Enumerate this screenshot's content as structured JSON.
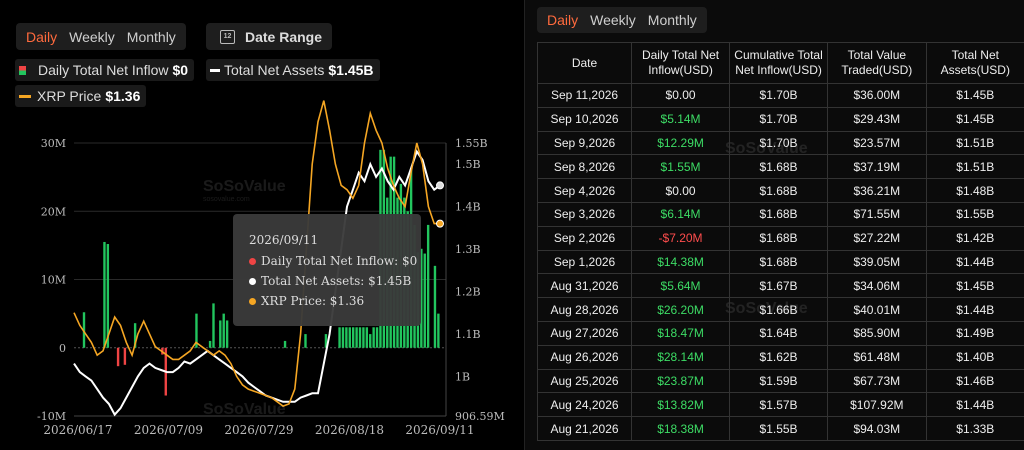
{
  "left": {
    "period_tabs": [
      "Daily",
      "Weekly",
      "Monthly"
    ],
    "active_tab": "Daily",
    "date_range_label": "Date Range",
    "date_range_icon": "calendar-icon",
    "legend": {
      "inflow_label": "Daily Total Net Inflow",
      "inflow_value": "$0",
      "assets_label": "Total Net Assets",
      "assets_value": "$1.45B",
      "price_label": "XRP Price",
      "price_value": "$1.36"
    },
    "watermark": "SoSoValue",
    "watermark_sub": "sosovalue.com",
    "tooltip": {
      "date": "2026/09/11",
      "inflow": "Daily Total Net Inflow: $0",
      "assets": "Total Net Assets: $1.45B",
      "price": "XRP Price: $1.36"
    }
  },
  "chart_data": {
    "type": "bar",
    "x_tick_labels": [
      "2026/06/17",
      "2026/07/09",
      "2026/07/29",
      "2026/08/18",
      "2026/09/11"
    ],
    "y_left_ticks": [
      "30M",
      "20M",
      "10M",
      "0",
      "-10M"
    ],
    "y_right_ticks": [
      "1.55B",
      "1.5B",
      "1.4B",
      "1.3B",
      "1.2B",
      "1.1B",
      "1B",
      "906.59M"
    ],
    "ylim_left": [
      -10,
      30
    ],
    "ylim_right": [
      0.90659,
      1.55
    ],
    "grid": true,
    "colors": {
      "positive": "#22c55e",
      "negative": "#ef4444",
      "assets": "#ffffff",
      "price": "#f5a623"
    },
    "series": [
      {
        "name": "Daily Total Net Inflow",
        "kind": "bar",
        "unit": "M",
        "values": [
          0,
          0,
          5.2,
          0,
          0,
          0,
          0,
          0,
          15.5,
          15.2,
          0,
          0,
          -2.7,
          0,
          -2.5,
          0,
          0,
          3.6,
          0,
          0,
          0,
          0,
          0,
          0,
          0,
          -1,
          -7,
          0,
          0,
          0,
          0,
          0,
          0,
          0,
          0,
          5,
          0,
          0,
          0,
          1,
          6.5,
          0,
          4,
          5,
          4,
          0,
          0,
          0,
          0,
          0,
          0,
          0,
          0,
          0,
          0,
          0,
          0,
          0,
          0,
          0,
          0,
          1,
          0,
          0,
          0,
          0,
          0,
          2,
          0,
          0,
          0,
          0,
          0,
          2,
          0,
          0,
          0,
          3,
          3,
          3,
          3,
          3,
          3,
          3,
          3,
          3,
          2,
          3,
          3,
          29,
          29,
          22,
          28,
          28,
          22,
          24,
          22,
          20,
          26,
          18,
          14,
          14.5,
          13.8,
          18,
          0,
          12,
          5,
          0
        ]
      },
      {
        "name": "Total Net Assets",
        "kind": "line",
        "unit": "B",
        "values": [
          1.03,
          1.01,
          1.0,
          0.99,
          0.97,
          0.95,
          0.935,
          0.91,
          0.925,
          0.95,
          0.975,
          1.0,
          1.02,
          1.03,
          1.02,
          1.015,
          1.01,
          1.01,
          1.02,
          1.035,
          1.03,
          1.04,
          1.05,
          1.06,
          1.05,
          1.04,
          1.03,
          1.02,
          1.01,
          1.0,
          0.985,
          0.975,
          0.965,
          0.955,
          0.95,
          0.945,
          0.94,
          0.94,
          0.94,
          0.95,
          0.955,
          0.96,
          0.96,
          1.03,
          1.1,
          1.2,
          1.3,
          1.4,
          1.44,
          1.48,
          1.46,
          1.5,
          1.47,
          1.49,
          1.46,
          1.44,
          1.47,
          1.45,
          1.49,
          1.53,
          1.51,
          1.46,
          1.44,
          1.45
        ]
      },
      {
        "name": "XRP Price",
        "kind": "line",
        "unit": "$",
        "values": [
          1.15,
          1.12,
          1.1,
          1.08,
          1.05,
          1.06,
          1.1,
          1.14,
          1.12,
          1.08,
          1.05,
          1.1,
          1.13,
          1.1,
          1.07,
          1.06,
          1.05,
          1.04,
          1.04,
          1.05,
          1.06,
          1.08,
          1.07,
          1.06,
          1.05,
          1.06,
          1.05,
          1.03,
          1.0,
          0.98,
          0.97,
          0.965,
          0.96,
          0.955,
          0.95,
          0.94,
          0.93,
          0.935,
          0.97,
          1.1,
          1.3,
          1.5,
          1.6,
          1.65,
          1.58,
          1.5,
          1.45,
          1.44,
          1.42,
          1.45,
          1.55,
          1.62,
          1.58,
          1.55,
          1.49,
          1.45,
          1.42,
          1.4,
          1.48,
          1.55,
          1.5,
          1.4,
          1.36,
          1.36
        ]
      }
    ]
  },
  "table": {
    "tabs": [
      "Daily",
      "Weekly",
      "Monthly"
    ],
    "active_tab": "Daily",
    "headers": [
      "Date",
      "Daily Total Net Inflow(USD)",
      "Cumulative Total Net Inflow(USD)",
      "Total Value Traded(USD)",
      "Total Net Assets(USD)"
    ],
    "rows": [
      [
        "Sep 11,2026",
        "$0.00",
        "$1.70B",
        "$36.00M",
        "$1.45B"
      ],
      [
        "Sep 10,2026",
        "$5.14M",
        "$1.70B",
        "$29.43M",
        "$1.45B"
      ],
      [
        "Sep 9,2026",
        "$12.29M",
        "$1.70B",
        "$23.57M",
        "$1.51B"
      ],
      [
        "Sep 8,2026",
        "$1.55M",
        "$1.68B",
        "$37.19M",
        "$1.51B"
      ],
      [
        "Sep 4,2026",
        "$0.00",
        "$1.68B",
        "$36.21M",
        "$1.48B"
      ],
      [
        "Sep 3,2026",
        "$6.14M",
        "$1.68B",
        "$71.55M",
        "$1.55B"
      ],
      [
        "Sep 2,2026",
        "-$7.20M",
        "$1.68B",
        "$27.22M",
        "$1.42B"
      ],
      [
        "Sep 1,2026",
        "$14.38M",
        "$1.68B",
        "$39.05M",
        "$1.44B"
      ],
      [
        "Aug 31,2026",
        "$5.64M",
        "$1.67B",
        "$34.06M",
        "$1.45B"
      ],
      [
        "Aug 28,2026",
        "$26.20M",
        "$1.66B",
        "$40.01M",
        "$1.44B"
      ],
      [
        "Aug 27,2026",
        "$18.47M",
        "$1.64B",
        "$85.90M",
        "$1.49B"
      ],
      [
        "Aug 26,2026",
        "$28.14M",
        "$1.62B",
        "$61.48M",
        "$1.40B"
      ],
      [
        "Aug 25,2026",
        "$23.87M",
        "$1.59B",
        "$67.73M",
        "$1.46B"
      ],
      [
        "Aug 24,2026",
        "$13.82M",
        "$1.57B",
        "$107.92M",
        "$1.44B"
      ],
      [
        "Aug 21,2026",
        "$18.38M",
        "$1.55B",
        "$94.03M",
        "$1.33B"
      ]
    ],
    "inflow_status": [
      "zero",
      "pos",
      "pos",
      "pos",
      "zero",
      "pos",
      "neg",
      "pos",
      "pos",
      "pos",
      "pos",
      "pos",
      "pos",
      "pos",
      "pos"
    ]
  }
}
